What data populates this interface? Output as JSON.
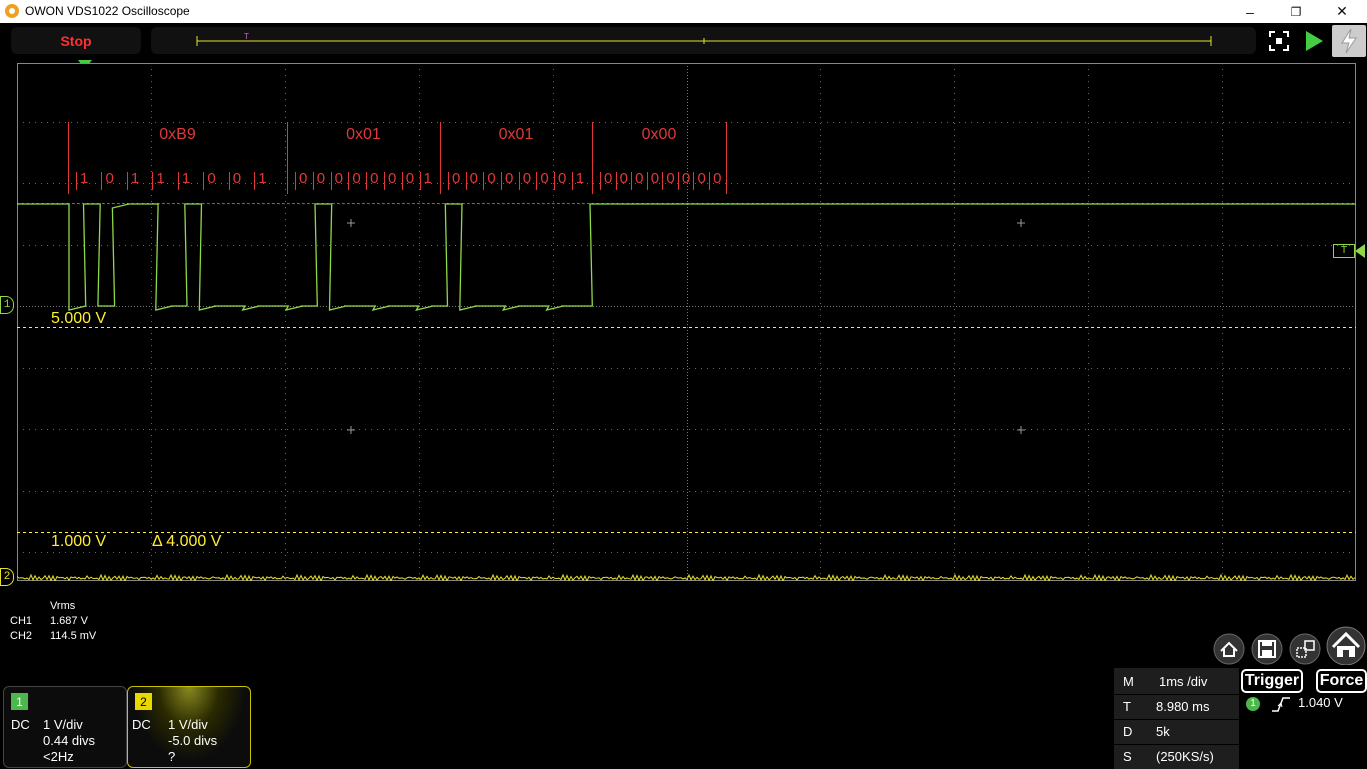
{
  "window": {
    "title": "OWON VDS1022 Oscilloscope",
    "minimize_glyph": "–",
    "restore_glyph": "❐",
    "close_glyph": "✕"
  },
  "toolbar": {
    "stop_label": "Stop"
  },
  "decode": {
    "bytes": [
      "0xB9",
      "0x01",
      "0x01",
      "0x00"
    ],
    "bits": [
      "1",
      "0",
      "1",
      "1",
      "1",
      "0",
      "0",
      "1",
      "0",
      "0",
      "0",
      "0",
      "0",
      "0",
      "0",
      "1",
      "0",
      "0",
      "0",
      "0",
      "0",
      "0",
      "0",
      "1",
      "0",
      "0",
      "0",
      "0",
      "0",
      "0",
      "0",
      "0"
    ]
  },
  "cursors": {
    "upper": "5.000 V",
    "lower": "1.000 V",
    "delta": "Δ 4.000 V"
  },
  "markers": {
    "ch1": "1",
    "ch2": "2",
    "trigger": "T"
  },
  "measurements": {
    "header": "Vrms",
    "ch1_label": "CH1",
    "ch1_value": "1.687 V",
    "ch2_label": "CH2",
    "ch2_value": "114.5 mV"
  },
  "channels": [
    {
      "num": "1",
      "coupling": "DC",
      "scale": "1 V/div",
      "offset": "0.44 divs",
      "freq": "<2Hz",
      "color": "#4cb84c"
    },
    {
      "num": "2",
      "coupling": "DC",
      "scale": "1 V/div",
      "offset": "-5.0 divs",
      "freq": "?",
      "color": "#e8d800"
    }
  ],
  "timebase": {
    "m_label": "M",
    "m_value": "1ms /div",
    "t_label": "T",
    "t_value": "8.980 ms",
    "d_label": "D",
    "d_value": "5k",
    "s_label": "S",
    "s_value": "(250KS/s)"
  },
  "trigger": {
    "trigger_label": "Trigger",
    "force_label": "Force",
    "channel": "1",
    "level": "1.040 V"
  },
  "colors": {
    "ch1": "#8ed84a",
    "ch2": "#e8e030",
    "decode": "#e03838",
    "grid": "#666666",
    "cursor": "#ffee33"
  }
}
